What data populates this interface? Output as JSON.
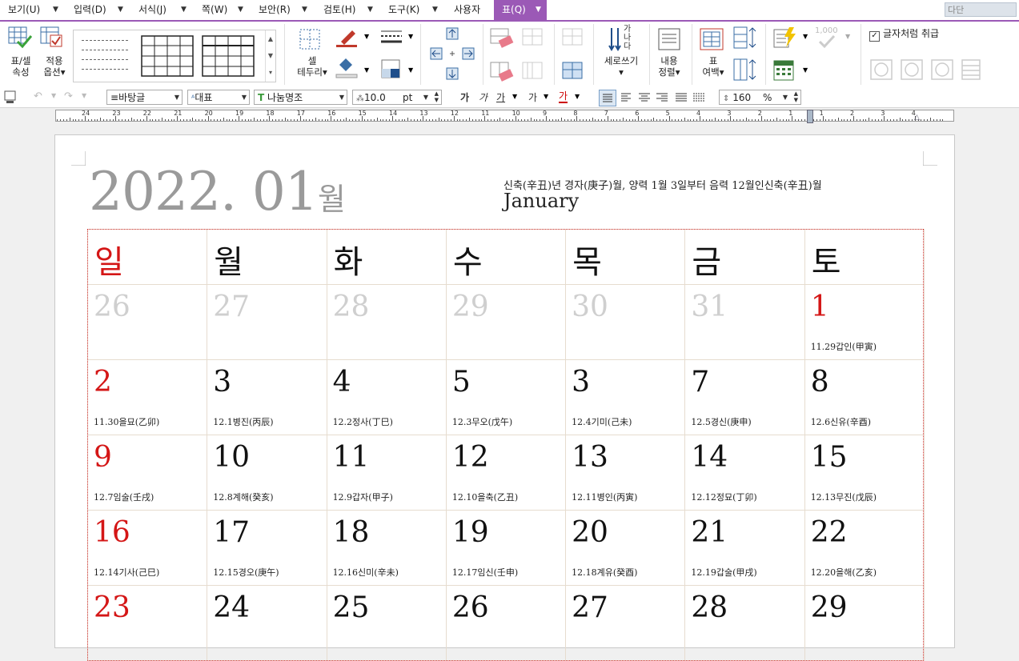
{
  "menu": {
    "items": [
      "보기(U)",
      "입력(D)",
      "서식(J)",
      "쪽(W)",
      "보안(R)",
      "검토(H)",
      "도구(K)",
      "사용자"
    ],
    "active": "표(Q)",
    "search_text": "다단"
  },
  "ribbon": {
    "table_cell_props": "표/셀\n속성",
    "table_cell_props_l1": "표/셀",
    "table_cell_props_l2": "속성",
    "apply_options_l1": "적용",
    "apply_options_l2": "옵션",
    "cell_border_l1": "셀",
    "cell_border_l2": "테두리",
    "vertical_text": "세로쓰기",
    "content_align_l1": "내용",
    "content_align_l2": "정렬",
    "table_margin_l1": "표",
    "table_margin_l2": "여백",
    "treat_as_char": "글자처럼 취급",
    "treat_as_char_checked": true,
    "vertical_icon_text": [
      "가",
      "나",
      "다"
    ],
    "number_faint": "1,000"
  },
  "format_bar": {
    "style": "바탕글",
    "representative": "대표",
    "font": "나눔명조",
    "font_size": "10.0",
    "unit": "pt",
    "bold_label": "가",
    "italic_label": "가",
    "underline_label": "가",
    "strike_label": "가",
    "color_label": "가",
    "line_spacing": "160",
    "line_spacing_unit": "%"
  },
  "ruler": {
    "numbers": [
      "24",
      "23",
      "22",
      "21",
      "20",
      "19",
      "18",
      "17",
      "16",
      "15",
      "14",
      "13",
      "12",
      "11",
      "10",
      "9",
      "8",
      "7",
      "6",
      "5",
      "4",
      "3",
      "2",
      "1",
      "1",
      "2",
      "3",
      "4"
    ]
  },
  "calendar": {
    "year_month": "2022. 01",
    "month_suffix": "월",
    "lunar_info": "신축(辛丑)년 경자(庚子)월, 양력 1월 3일부터 음력 12월인신축(辛丑)월",
    "english_month": "January",
    "day_names": [
      "일",
      "월",
      "화",
      "수",
      "목",
      "금",
      "토"
    ],
    "weeks": [
      [
        {
          "day": "26",
          "lunar": "",
          "style": "gray"
        },
        {
          "day": "27",
          "lunar": "",
          "style": "gray"
        },
        {
          "day": "28",
          "lunar": "",
          "style": "gray"
        },
        {
          "day": "29",
          "lunar": "",
          "style": "gray"
        },
        {
          "day": "30",
          "lunar": "",
          "style": "gray"
        },
        {
          "day": "31",
          "lunar": "",
          "style": "gray"
        },
        {
          "day": "1",
          "lunar": "11.29갑인(甲寅)",
          "style": "red"
        }
      ],
      [
        {
          "day": "2",
          "lunar": "11.30을묘(乙卯)",
          "style": "red"
        },
        {
          "day": "3",
          "lunar": "12.1병진(丙辰)",
          "style": "normal"
        },
        {
          "day": "4",
          "lunar": "12.2정사(丁巳)",
          "style": "normal"
        },
        {
          "day": "5",
          "lunar": "12.3무오(戊午)",
          "style": "normal"
        },
        {
          "day": "3",
          "lunar": "12.4기미(己未)",
          "style": "normal"
        },
        {
          "day": "7",
          "lunar": "12.5경신(庚申)",
          "style": "normal"
        },
        {
          "day": "8",
          "lunar": "12.6신유(辛酉)",
          "style": "normal"
        }
      ],
      [
        {
          "day": "9",
          "lunar": "12.7임술(壬戌)",
          "style": "red"
        },
        {
          "day": "10",
          "lunar": "12.8계해(癸亥)",
          "style": "normal"
        },
        {
          "day": "11",
          "lunar": "12.9갑자(甲子)",
          "style": "normal"
        },
        {
          "day": "12",
          "lunar": "12.10을축(乙丑)",
          "style": "normal"
        },
        {
          "day": "13",
          "lunar": "12.11병인(丙寅)",
          "style": "normal"
        },
        {
          "day": "14",
          "lunar": "12.12정묘(丁卯)",
          "style": "normal"
        },
        {
          "day": "15",
          "lunar": "12.13무진(戊辰)",
          "style": "normal"
        }
      ],
      [
        {
          "day": "16",
          "lunar": "12.14기사(己巳)",
          "style": "red"
        },
        {
          "day": "17",
          "lunar": "12.15경오(庚午)",
          "style": "normal"
        },
        {
          "day": "18",
          "lunar": "12.16신미(辛未)",
          "style": "normal"
        },
        {
          "day": "19",
          "lunar": "12.17임신(壬申)",
          "style": "normal"
        },
        {
          "day": "20",
          "lunar": "12.18계유(癸酉)",
          "style": "normal"
        },
        {
          "day": "21",
          "lunar": "12.19갑술(甲戌)",
          "style": "normal"
        },
        {
          "day": "22",
          "lunar": "12.20을해(乙亥)",
          "style": "normal"
        }
      ],
      [
        {
          "day": "23",
          "lunar": "",
          "style": "red"
        },
        {
          "day": "24",
          "lunar": "",
          "style": "normal"
        },
        {
          "day": "25",
          "lunar": "",
          "style": "normal"
        },
        {
          "day": "26",
          "lunar": "",
          "style": "normal"
        },
        {
          "day": "27",
          "lunar": "",
          "style": "normal"
        },
        {
          "day": "28",
          "lunar": "",
          "style": "normal"
        },
        {
          "day": "29",
          "lunar": "",
          "style": "normal"
        }
      ]
    ]
  },
  "colors": {
    "accent": "#9b59b6",
    "sunday_red": "#d41616",
    "faded_gray": "#cfcfcf",
    "year_gray": "#9a9a9a"
  }
}
